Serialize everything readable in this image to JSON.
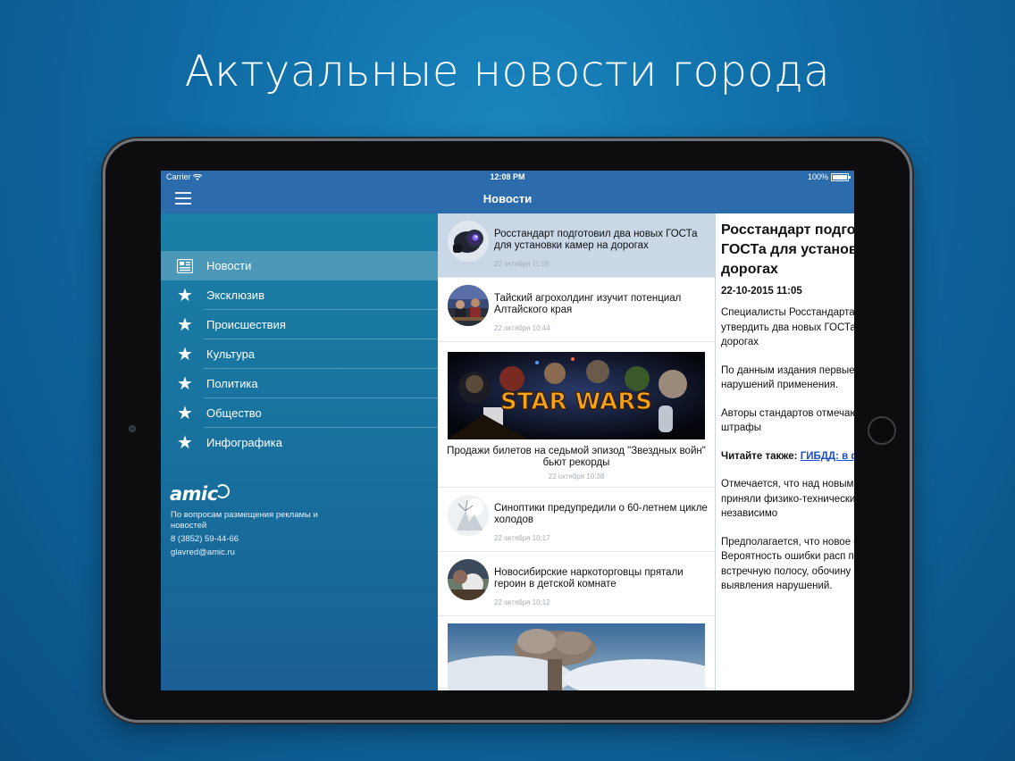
{
  "headline": "Актуальные новости города",
  "status_bar": {
    "carrier": "Carrier",
    "time": "12:08 PM",
    "battery": "100%"
  },
  "navbar": {
    "title": "Новости",
    "menu_icon": "hamburger-icon"
  },
  "sidebar": {
    "items": [
      {
        "label": "Новости",
        "icon": "newspaper-icon",
        "active": true
      },
      {
        "label": "Эксклюзив",
        "icon": "star-icon"
      },
      {
        "label": "Происшествия",
        "icon": "star-icon"
      },
      {
        "label": "Культура",
        "icon": "star-icon"
      },
      {
        "label": "Политика",
        "icon": "star-icon"
      },
      {
        "label": "Общество",
        "icon": "star-icon"
      },
      {
        "label": "Инфографика",
        "icon": "star-icon"
      }
    ],
    "logo": "amic",
    "contact_text": "По вопросам размещения рекламы и новостей",
    "phone": "8 (3852) 59-44-66",
    "email": "glavred@amic.ru"
  },
  "news": [
    {
      "title": "Росстандарт подготовил два новых ГОСТа для установки камер на дорогах",
      "date": "22 октября 11:05",
      "thumb": "camera-photo",
      "selected": true
    },
    {
      "title": "Тайский агрохолдинг изучит потенциал Алтайского края",
      "date": "22 октября 10:44",
      "thumb": "meeting-photo"
    },
    {
      "title": "Продажи билетов на седьмой эпизод \"Звездных войн\" бьют рекорды",
      "date": "22 октября 10:38",
      "image_text": "STAR WARS"
    },
    {
      "title": "Синоптики предупредили о 60-летнем цикле холодов",
      "date": "22 октября 10:17",
      "thumb": "snow-photo"
    },
    {
      "title": "Новосибирские наркоторговцы прятали героин в детской комнате",
      "date": "22 октября 10:12",
      "thumb": "room-photo"
    }
  ],
  "article": {
    "title": "Росстандарт подготовил два новых ГОСТа для установки камер на дорогах",
    "date": "22-10-2015 11:05",
    "p1": "Специалисты Росстандарта провели экспертизы\" и утвердить два новых ГОСТа для видеофиксаций на дорогах",
    "p2": "По данным издания первые фотовидеофиксации нарушений применения.",
    "p3": "Авторы стандартов отмечают, что перестанут получать штрафы",
    "read_also_label": "Читайте также:",
    "read_also_link": "ГИБДД: в фотовидеофиксации",
    "p4": "Отмечается, что над новыми лет. В создании ГОСТов приняли физико-технических и радио автомобилистов, независимо",
    "p5": "Предполагается, что новое определения скорости — Вероятность ошибки расп прибор должен уметь опред встречную полосу, обочину регламентировано количе выявления нарушений."
  }
}
